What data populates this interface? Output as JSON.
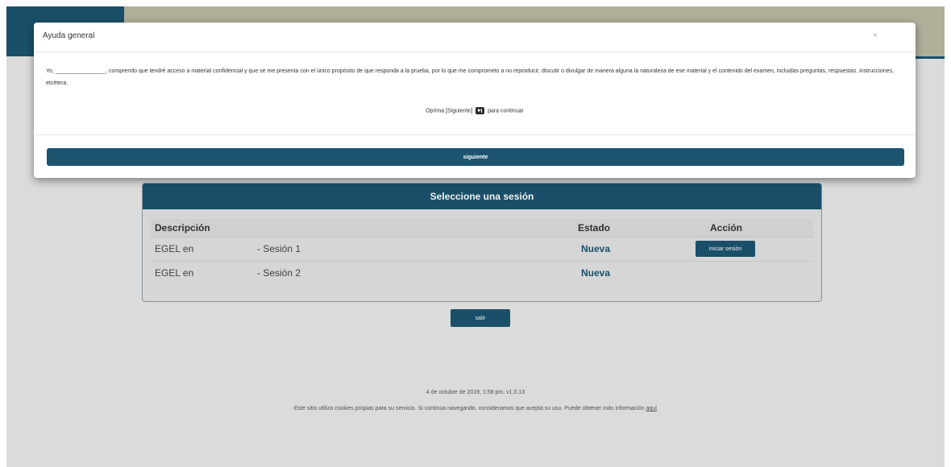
{
  "modal": {
    "title": "Ayuda general",
    "close_label": "×",
    "body_text": "Yo, ________________, comprendo que tendré acceso a material confidencial y que se me presenta con el único propósito de que responda a la prueba, por lo que me comprometo a no reproducir, discutir o divulgar de manera alguna la naturaleza de ese material y el contenido del examen, incluidas preguntas, respuestas, instrucciones, etcétera.",
    "continue_prefix": "Oprima [Siguiente]",
    "continue_suffix": "para continuar",
    "next_icon": "next-icon",
    "next_button": "siguiente"
  },
  "sessions": {
    "header": "Seleccione una sesión",
    "columns": [
      "Descripción",
      "Estado",
      "Acción"
    ],
    "rows": [
      {
        "name": "EGEL en",
        "session": "- Sesión 1",
        "status": "Nueva",
        "action": "iniciar sesión"
      },
      {
        "name": "EGEL en",
        "session": "- Sesión 2",
        "status": "Nueva"
      }
    ]
  },
  "exit_button": "salir",
  "footer": {
    "date": "4 de octubre de 2019, 1:58 pm. v1.0.13",
    "cookie_text": "Este sitio utiliza cookies propias para su servicio. Si continua navegando, consideramos que acepta su uso. Puede obtener más información",
    "cookie_link": "aquí"
  },
  "colors": {
    "primary": "#1c5470",
    "header_band": "#bdb9a4",
    "page_bg": "#e9e9e9"
  }
}
